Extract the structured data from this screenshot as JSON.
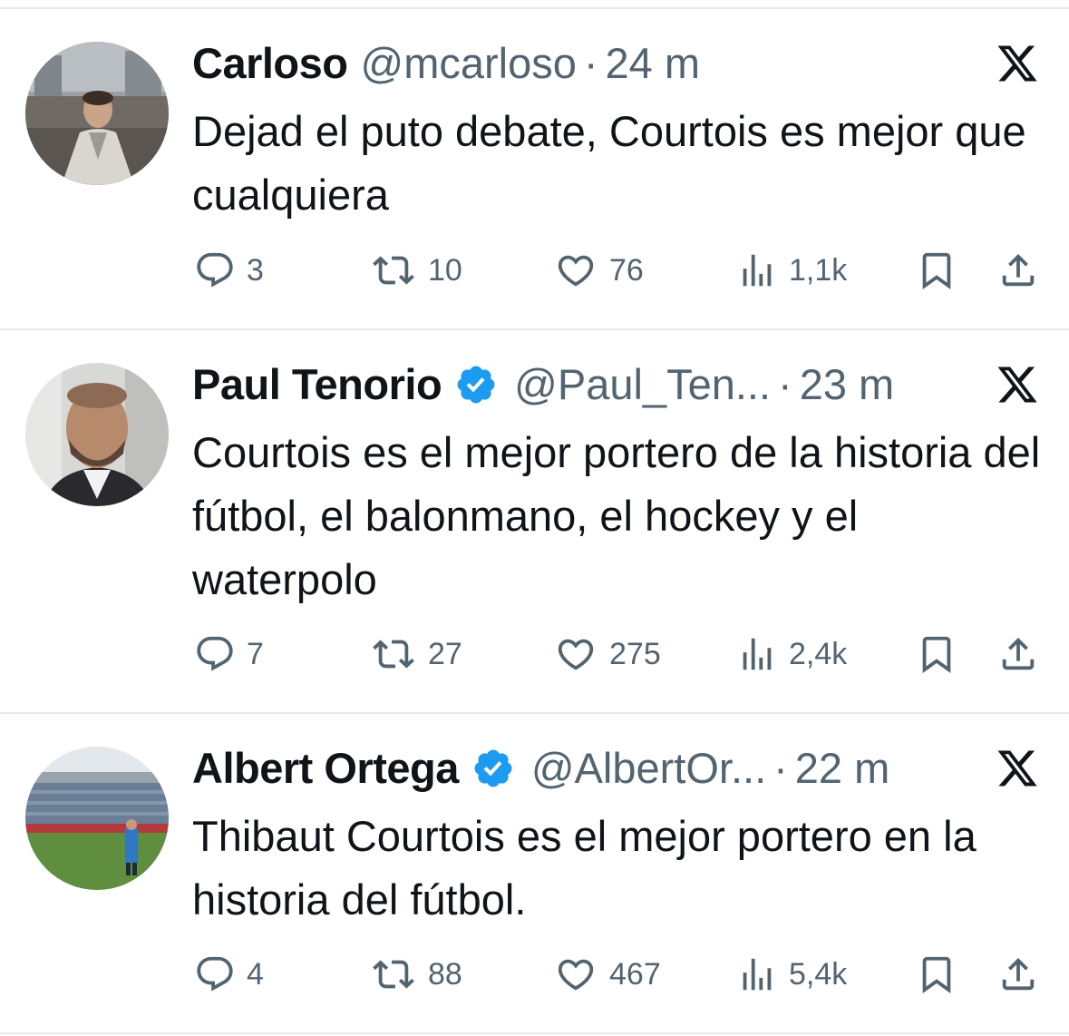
{
  "tweets": [
    {
      "name": "Carloso",
      "verified": false,
      "handle": "@mcarloso",
      "separator": "·",
      "time": "24 m",
      "text": "Dejad el puto debate, Courtois es mejor que cualquiera",
      "replies": "3",
      "reposts": "10",
      "likes": "76",
      "views": "1,1k"
    },
    {
      "name": "Paul Tenorio",
      "verified": true,
      "handle": "@Paul_Ten...",
      "separator": "·",
      "time": "23 m",
      "text": "Courtois es el mejor portero de la historia del fútbol, el balonmano, el hockey y el waterpolo",
      "replies": "7",
      "reposts": "27",
      "likes": "275",
      "views": "2,4k"
    },
    {
      "name": "Albert Ortega",
      "verified": true,
      "handle": "@AlbertOr...",
      "separator": "·",
      "time": "22 m",
      "text": "Thibaut Courtois es el mejor portero en la historia del fútbol.",
      "replies": "4",
      "reposts": "88",
      "likes": "467",
      "views": "5,4k"
    }
  ],
  "icons": {
    "reply": "reply-icon",
    "repost": "repost-icon",
    "like": "heart-icon",
    "views": "views-icon",
    "bookmark": "bookmark-icon",
    "share": "share-icon",
    "brand": "x-logo-icon",
    "verified": "verified-badge-icon"
  },
  "colors": {
    "text": "#0f1419",
    "secondary": "#536471",
    "verified": "#1d9bf0",
    "divider": "#e6e9ec"
  }
}
